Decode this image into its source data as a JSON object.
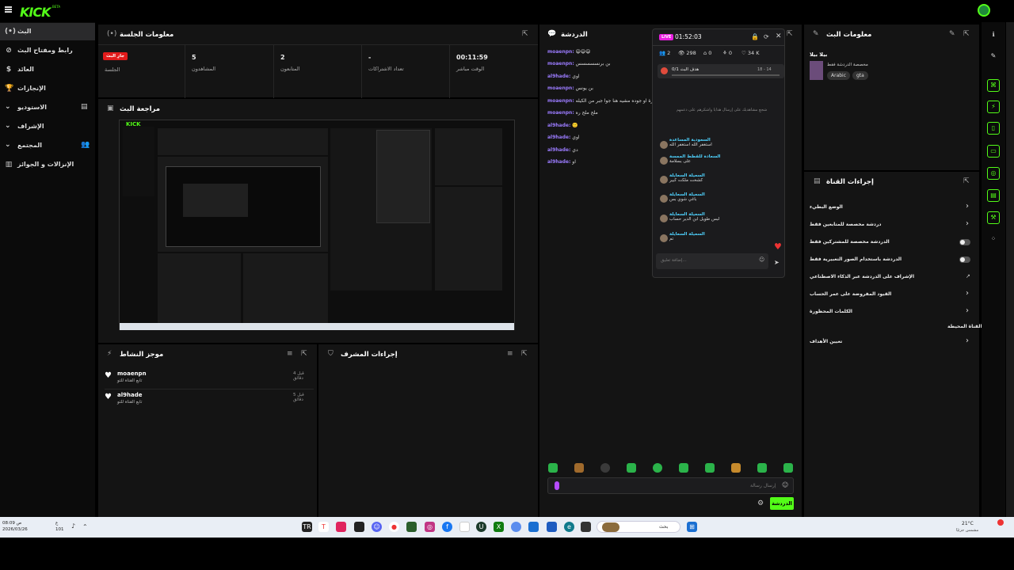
{
  "topbar": {
    "logo": "KICK",
    "beta": "BETA"
  },
  "sidebar": {
    "items": [
      {
        "label": "البث",
        "icon": "(•)"
      },
      {
        "label": "رابط ومفتاح البث",
        "icon": "⊘"
      },
      {
        "label": "العائد",
        "icon": "$"
      },
      {
        "label": "الإنجازات",
        "icon": "🏆"
      },
      {
        "label": "الاستوديو",
        "icon": "▤"
      },
      {
        "label": "الإشراف",
        "icon": "⚔"
      },
      {
        "label": "المجتمع",
        "icon": "👥"
      },
      {
        "label": "الإنزالات و الجوائز",
        "icon": "▥"
      }
    ]
  },
  "session": {
    "title": "معلومات الجلسة",
    "badge": "جارِ البث",
    "stats": [
      {
        "value": "",
        "label": "الجلسة"
      },
      {
        "value": "5",
        "label": "المشاهدون"
      },
      {
        "value": "2",
        "label": "المتابعون"
      },
      {
        "value": "-",
        "label": "تعداد الاشتراكات"
      },
      {
        "value": "00:11:59",
        "label": "الوقت مباشر"
      }
    ]
  },
  "preview": {
    "title": "مراجعة البث"
  },
  "activity": {
    "title": "موجز النشاط",
    "items": [
      {
        "user": "moaenpn",
        "text": "تابع القناة للتو",
        "time": "قبل 4 دقائق"
      },
      {
        "user": "al9hade",
        "text": "تابع القناة للتو",
        "time": "قبل 5 دقائق"
      }
    ]
  },
  "mod_actions": {
    "title": "إجراءات المشرف"
  },
  "chat": {
    "title": "الدردشة",
    "messages": [
      {
        "user": "moaenpn:",
        "text": "😄😄😄"
      },
      {
        "user": "moaenpn:",
        "text": "بن برنسسسسس"
      },
      {
        "user": "al9hade:",
        "text": "اوي"
      },
      {
        "user": "moaenpn:",
        "text": "بن يونس"
      },
      {
        "user": "moaenpn:",
        "text": "سحب بيازة او جوده مشيه هنا جوا جبر من الكيله"
      },
      {
        "user": "moaenpn:",
        "text": "ملح ملح ره"
      },
      {
        "user": "al9hade:",
        "text": "🙂"
      },
      {
        "user": "al9hade:",
        "text": "اوي"
      },
      {
        "user": "al9hade:",
        "text": "دي"
      },
      {
        "user": "al9hade:",
        "text": "او"
      }
    ],
    "input_placeholder": "إرسال رسالة",
    "send_button": "الدردشة"
  },
  "popup": {
    "live": "LIVE",
    "timer": "01:52:03",
    "stats": [
      {
        "icon": "👥",
        "value": "2"
      },
      {
        "icon": "👁",
        "value": "298"
      },
      {
        "icon": "⌂",
        "value": "0"
      },
      {
        "icon": "⚘",
        "value": "0"
      },
      {
        "icon": "♡",
        "value": "34 K"
      }
    ],
    "goal_label": "هدف البث",
    "goal_value": "0/1",
    "goal_range": "18 - 14",
    "notice": "شجع مشاهديك على إرسال هدايا واشكرهم على دعمهم",
    "messages": [
      {
        "user": "السعودية المساعدة",
        "text": "استغفر الله استغفر الله"
      },
      {
        "user": "السعادة للقطط الممسة",
        "text": "على بسلامة"
      },
      {
        "user": "السعيلة السعايلة",
        "text": "كشخت ملكت كبير"
      },
      {
        "user": "السعيلة السعايلة",
        "text": "باغي شوي بس"
      },
      {
        "user": "السعيلة السعايلة",
        "text": "لبس طويل ابن الدير حساب"
      },
      {
        "user": "السعيلة السعايلة",
        "text": "تم"
      }
    ],
    "input_placeholder": "إضافة تعليق..."
  },
  "stream_info": {
    "title": "معلومات البث",
    "name": "بيلا بيلا",
    "category": "مخصصة الدردشة فقط",
    "tags": [
      "Arabic",
      "gta"
    ]
  },
  "channel_actions": {
    "title": "إجراءات القناة",
    "items": [
      {
        "label": "الوضع البطيء",
        "control": "chevron"
      },
      {
        "label": "دردشة مخصصة للمتابعين فقط",
        "control": "chevron"
      },
      {
        "label": "الدردشة مخصصة للمشتركين فقط",
        "control": "toggle"
      },
      {
        "label": "الدردشة باستخدام الصور التعبيرية فقط",
        "control": "toggle"
      },
      {
        "label": "الإشراف على الدردشة عبر الذكاء الاصطناعي",
        "control": "external"
      },
      {
        "label": "القيود المفروضة على عمر الحساب",
        "control": "chevron"
      },
      {
        "label": "الكلمات المحظورة",
        "control": "chevron"
      },
      {
        "label": "القناة المحيطة",
        "control": "none"
      },
      {
        "label": "تعيين الأهداف",
        "control": "chevron"
      }
    ]
  },
  "taskbar": {
    "weather": "21°C",
    "weather_sub": "مشمس جزئيًا",
    "search": "بحث",
    "time": "08:09 ص",
    "date": "2026/03/26",
    "lang": "ع",
    "battery": "101"
  },
  "colors": {
    "brand": "#53fc18",
    "live": "#e21b1b",
    "accent_user": "#9b7bff"
  }
}
